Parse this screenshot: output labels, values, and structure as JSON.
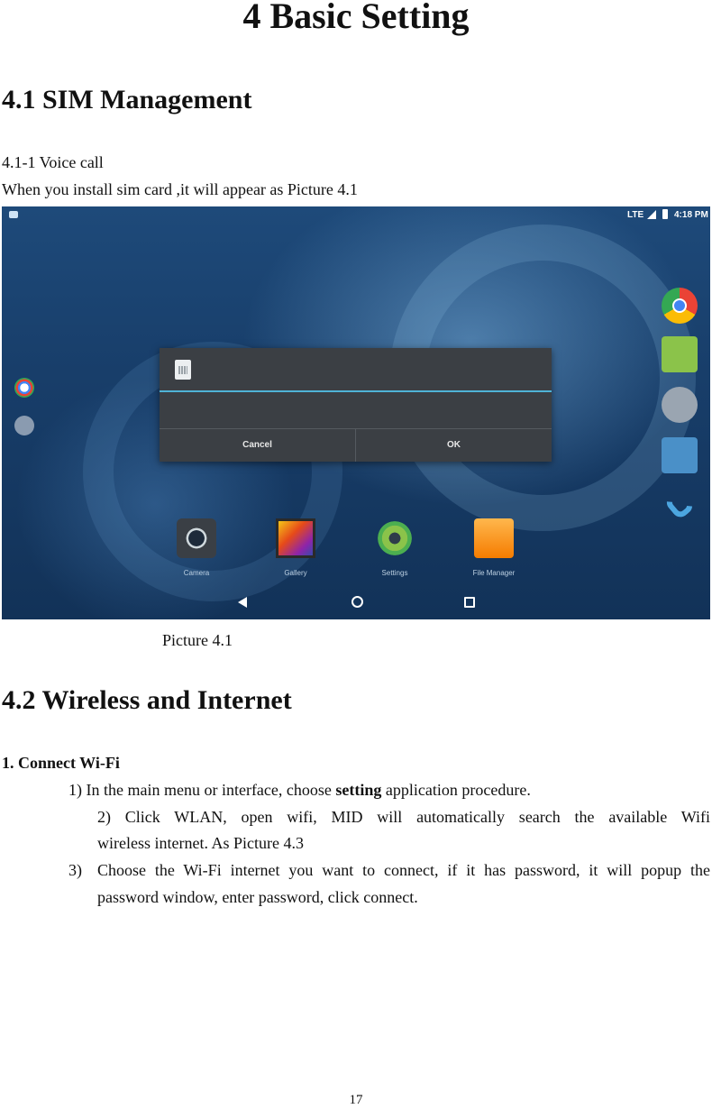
{
  "document": {
    "title": "4 Basic Setting",
    "section1_heading": "4.1 SIM Management",
    "subsection_1": "4.1-1 Voice call",
    "sim_intro": "When you install sim card ,it will appear as Picture 4.1",
    "picture_caption": "Picture 4.1",
    "section2_heading": "4.2 Wireless and Internet",
    "wifi_heading": "1. Connect Wi-Fi",
    "step1_prefix": "1) In the main menu or interface, choose ",
    "step1_bold": "setting",
    "step1_suffix": " application procedure.",
    "step2_line1": "2) Click WLAN, open wifi, MID will automatically search the available Wifi",
    "step2_line2": "wireless internet. As Picture 4.3",
    "step3_number": "3)",
    "step3_line1": "Choose the Wi-Fi internet you want to connect, if it has password, it will popup the",
    "step3_line2": "password window, enter password, click connect.",
    "page_number": "17"
  },
  "screenshot": {
    "status_bar": {
      "network": "LTE",
      "time": "4:18 PM"
    },
    "dialog": {
      "cancel_label": "Cancel",
      "ok_label": "OK"
    },
    "dock": [
      {
        "label": "Camera",
        "icon": "camera-icon"
      },
      {
        "label": "Gallery",
        "icon": "gallery-icon"
      },
      {
        "label": "Settings",
        "icon": "settings-icon"
      },
      {
        "label": "File Manager",
        "icon": "file-manager-icon"
      }
    ],
    "side_apps": [
      "chrome-icon",
      "messaging-icon",
      "app-drawer-icon",
      "contacts-icon",
      "phone-icon"
    ],
    "left_icons": [
      "google-icon",
      "info-icon"
    ],
    "nav": [
      "back-icon",
      "home-icon",
      "recents-icon"
    ],
    "colors": {
      "dialog_accent": "#4fb3d6",
      "wallpaper": "#1e4a7a"
    }
  }
}
